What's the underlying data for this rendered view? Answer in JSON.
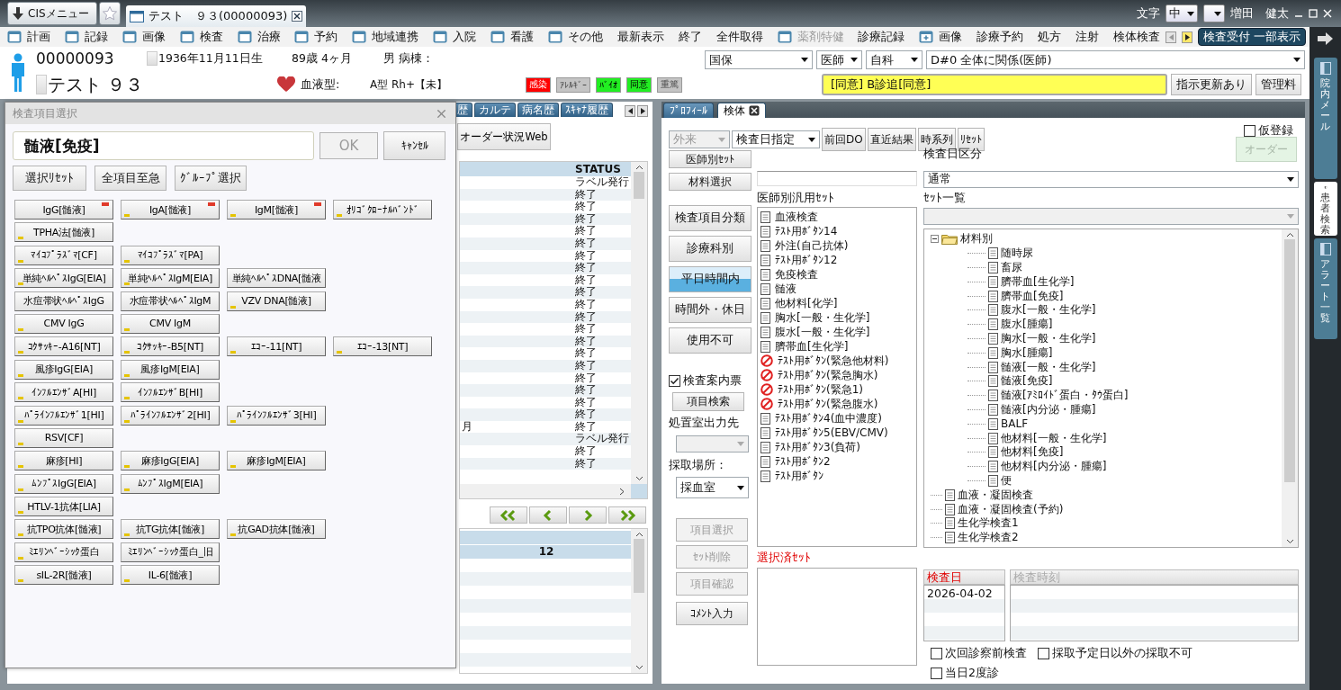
{
  "title_bar": {
    "menu_button": "CISメニュー",
    "tabs": [
      {
        "title": "テスト　９３(00000093)",
        "selected": true
      }
    ],
    "font_label": "文字",
    "font_size": "中",
    "user": "増田　健太"
  },
  "menu_bar": {
    "items": [
      {
        "label": "計画",
        "kind": "window",
        "disabled": false
      },
      {
        "label": "記録",
        "kind": "window",
        "disabled": false
      },
      {
        "label": "画像",
        "kind": "window",
        "disabled": false
      },
      {
        "label": "検査",
        "kind": "window",
        "disabled": false
      },
      {
        "label": "治療",
        "kind": "window",
        "disabled": false
      },
      {
        "label": "予約",
        "kind": "window",
        "disabled": false
      },
      {
        "label": "地域連携",
        "kind": "window",
        "disabled": false
      },
      {
        "label": "入院",
        "kind": "window",
        "disabled": false
      },
      {
        "label": "看護",
        "kind": "window",
        "disabled": false
      },
      {
        "label": "その他",
        "kind": "window",
        "disabled": false
      },
      {
        "label": "最新表示",
        "kind": "text",
        "disabled": false
      },
      {
        "label": "終了",
        "kind": "text",
        "disabled": false
      },
      {
        "label": "全件取得",
        "kind": "text",
        "disabled": false
      },
      {
        "label": "薬剤特健",
        "kind": "window",
        "disabled": true
      },
      {
        "label": "診療記録",
        "kind": "text",
        "disabled": false
      },
      {
        "label": "画像",
        "kind": "plus",
        "disabled": false
      },
      {
        "label": "診療予約",
        "kind": "text",
        "disabled": false
      },
      {
        "label": "処方",
        "kind": "text",
        "disabled": false
      },
      {
        "label": "注射",
        "kind": "text",
        "disabled": false
      },
      {
        "label": "検体検査",
        "kind": "text",
        "disabled": false
      }
    ],
    "action_button": "検査受付 一部表示"
  },
  "patient": {
    "id": "00000093",
    "birth": "1936年11月11日生",
    "age": "89歳 4ヶ月",
    "sex_ward": "男 病棟：",
    "name": "テスト ９３",
    "blood_label": "血液型:",
    "blood_type": "A型 Rh+【未】",
    "flags": [
      {
        "label": "感染",
        "on": true,
        "color": "#ff0000"
      },
      {
        "label": "ｱﾚﾙｷﾞｰ",
        "on": false
      },
      {
        "label": "ﾊﾞｲｵ",
        "on": true,
        "color": "#22ee22"
      },
      {
        "label": "同意",
        "on": true,
        "color": "#22ee22"
      },
      {
        "label": "重篤",
        "on": false
      }
    ],
    "selects": [
      "国保",
      "医師",
      "自科",
      "D#0  全体に関係(医師)"
    ],
    "notice": "[同意] B診追[同意]",
    "buttons": [
      "指示更新あり",
      "管理料"
    ]
  },
  "order_panel": {
    "tabs": [
      {
        "label": "歴",
        "selected": false
      },
      {
        "label": "カルテ",
        "selected": false
      },
      {
        "label": "病名歴",
        "selected": false
      },
      {
        "label": "ｽｷｬﾅ履歴",
        "selected": false
      }
    ],
    "web_button": "オーダー状況Web",
    "status_header": "STATUS",
    "rows": [
      {
        "status": "ラベル発行"
      },
      {
        "status": "終了"
      },
      {
        "status": "終了"
      },
      {
        "status": "終了"
      },
      {
        "status": "終了"
      },
      {
        "status": "終了"
      },
      {
        "status": "終了"
      },
      {
        "status": "終了"
      },
      {
        "status": "終了"
      },
      {
        "status": "終了"
      },
      {
        "status": "終了"
      },
      {
        "status": "終了"
      },
      {
        "status": "終了"
      },
      {
        "status": "終了"
      },
      {
        "status": "終了"
      },
      {
        "status": "終了"
      },
      {
        "status": "終了"
      },
      {
        "status": "終了"
      },
      {
        "status": "終了"
      },
      {
        "status": "終了"
      },
      {
        "column_1": "月",
        "status": "終了"
      },
      {
        "status": "ラベル発行"
      },
      {
        "status": "終了"
      },
      {
        "status": "終了"
      }
    ],
    "lower_row": {
      "value": "12",
      "selected": true
    }
  },
  "dialog": {
    "title": "検査項目選択",
    "selection": "髄液[免疫]",
    "ok": {
      "label": "OK",
      "disabled": true
    },
    "cancel": "ｷｬﾝｾﾙ",
    "actions": [
      "選択ﾘｾｯﾄ",
      "全項目至急",
      "ｸﾞﾙｰﾌﾟ選択"
    ],
    "item_rows": [
      [
        {
          "label": "IgG[髄液]",
          "flagged": true,
          "marked": false
        },
        {
          "label": "IgA[髄液]",
          "flagged": true,
          "marked": true
        },
        {
          "label": "IgM[髄液]",
          "flagged": true,
          "marked": true
        },
        {
          "label": "ｵﾘｺﾞｸﾛｰﾅﾙﾊﾞﾝﾄﾞ",
          "flagged": false,
          "marked": true
        }
      ],
      [
        {
          "label": "TPHA法[髄液]",
          "flagged": false,
          "marked": true
        }
      ],
      [
        {
          "label": "ﾏｲｺﾌﾟﾗｽﾞﾏ[CF]",
          "flagged": false,
          "marked": true
        },
        {
          "label": "ﾏｲｺﾌﾟﾗｽﾞﾏ[PA]",
          "flagged": false,
          "marked": true
        }
      ],
      [
        {
          "label": "単純ﾍﾙﾍﾟｽIgG[EIA]",
          "flagged": false,
          "marked": true
        },
        {
          "label": "単純ﾍﾙﾍﾟｽIgM[EIA]",
          "flagged": false,
          "marked": true
        },
        {
          "label": "単純ﾍﾙﾍﾟｽDNA[髄液",
          "flagged": false,
          "marked": false
        }
      ],
      [
        {
          "label": "水痘帯状ﾍﾙﾍﾟｽIgG",
          "flagged": false,
          "marked": false
        },
        {
          "label": "水痘帯状ﾍﾙﾍﾟｽIgM",
          "flagged": false,
          "marked": false
        },
        {
          "label": "VZV DNA[髄液]",
          "flagged": false,
          "marked": true
        }
      ],
      [
        {
          "label": "CMV IgG",
          "flagged": false,
          "marked": true
        },
        {
          "label": "CMV IgM",
          "flagged": false,
          "marked": true
        }
      ],
      [
        {
          "label": "ｺｸｻｯｷｰ-A16[NT]",
          "flagged": false,
          "marked": true
        },
        {
          "label": "ｺｸｻｯｷｰ-B5[NT]",
          "flagged": false,
          "marked": true
        },
        {
          "label": "ｴｺｰ-11[NT]",
          "flagged": false,
          "marked": true
        },
        {
          "label": "ｴｺｰ-13[NT]",
          "flagged": false,
          "marked": true
        }
      ],
      [
        {
          "label": "風疹IgG[EIA]",
          "flagged": false,
          "marked": true
        },
        {
          "label": "風疹IgM[EIA]",
          "flagged": false,
          "marked": true
        }
      ],
      [
        {
          "label": "ｲﾝﾌﾙｴﾝｻﾞA[HI]",
          "flagged": false,
          "marked": true
        },
        {
          "label": "ｲﾝﾌﾙｴﾝｻﾞB[HI]",
          "flagged": false,
          "marked": true
        }
      ],
      [
        {
          "label": "ﾊﾟﾗｲﾝﾌﾙｴﾝｻﾞ1[HI]",
          "flagged": false,
          "marked": true
        },
        {
          "label": "ﾊﾟﾗｲﾝﾌﾙｴﾝｻﾞ2[HI]",
          "flagged": false,
          "marked": true
        },
        {
          "label": "ﾊﾟﾗｲﾝﾌﾙｴﾝｻﾞ3[HI]",
          "flagged": false,
          "marked": true
        }
      ],
      [
        {
          "label": "RSV[CF]",
          "flagged": false,
          "marked": true
        }
      ],
      [
        {
          "label": "麻疹[HI]",
          "flagged": false,
          "marked": true
        },
        {
          "label": "麻疹IgG[EIA]",
          "flagged": false,
          "marked": true
        },
        {
          "label": "麻疹IgM[EIA]",
          "flagged": false,
          "marked": true
        }
      ],
      [
        {
          "label": "ﾑﾝﾌﾟｽIgG[EIA]",
          "flagged": false,
          "marked": true
        },
        {
          "label": "ﾑﾝﾌﾟｽIgM[EIA]",
          "flagged": false,
          "marked": true
        }
      ],
      [
        {
          "label": "HTLV-1抗体[LIA]",
          "flagged": false,
          "marked": true
        }
      ],
      [
        {
          "label": "抗TPO抗体[髄液]",
          "flagged": false,
          "marked": true
        },
        {
          "label": "抗TG抗体[髄液]",
          "flagged": false,
          "marked": true
        },
        {
          "label": "抗GAD抗体[髄液]",
          "flagged": false,
          "marked": true
        }
      ],
      [
        {
          "label": "ﾐｴﾘﾝﾍﾞｰｼｯｸ蛋白",
          "flagged": false,
          "marked": true
        },
        {
          "label": "ﾐｴﾘﾝﾍﾞｰｼｯｸ蛋白_旧",
          "flagged": false,
          "marked": false
        }
      ],
      [
        {
          "label": "sIL-2R[髄液]",
          "flagged": false,
          "marked": true
        },
        {
          "label": "IL-6[髄液]",
          "flagged": false,
          "marked": true
        }
      ]
    ]
  },
  "right_panel": {
    "tabs": [
      {
        "label": "ﾌﾟﾛﾌｨｰﾙ",
        "selected": false,
        "closable": false
      },
      {
        "label": "検体",
        "selected": true,
        "closable": true
      }
    ],
    "visit_select": {
      "value": "外来",
      "disabled": true
    },
    "date_mode_select": {
      "value": "検査日指定",
      "disabled": false
    },
    "toolbar_buttons": [
      "前回DO",
      "直近結果",
      "時系列",
      "ﾘｾｯﾄ"
    ],
    "provisional": {
      "label": "仮登録",
      "checked": false
    },
    "order_button": {
      "label": "オーダー",
      "disabled": true
    },
    "side_buttons": [
      "医師別ｾｯﾄ",
      "材料選択"
    ],
    "category_buttons": [
      {
        "label": "検査項目分類",
        "selected": false
      },
      {
        "label": "診療科別",
        "selected": false
      },
      {
        "label": "平日時間内",
        "selected": true
      },
      {
        "label": "時間外・休日",
        "selected": false
      },
      {
        "label": "使用不可",
        "selected": false
      }
    ],
    "guide_check": {
      "label": "検査案内票",
      "checked": true
    },
    "item_search": "項目検索",
    "output_label": "処置室出力先",
    "output_select": {
      "disabled": true
    },
    "place_label": "採取場所：",
    "place_select": "採血室",
    "action_buttons": [
      {
        "label": "項目選択",
        "disabled": true
      },
      {
        "label": "ｾｯﾄ削除",
        "disabled": true
      },
      {
        "label": "項目確認",
        "disabled": true
      },
      {
        "label": "ｺﾒﾝﾄ入力",
        "disabled": false
      }
    ],
    "doctor_sets": {
      "label": "医師別汎用ｾｯﾄ",
      "items": [
        {
          "label": "血液検査",
          "kind": "document"
        },
        {
          "label": "ﾃｽﾄ用ﾎﾞﾀﾝ14",
          "kind": "document"
        },
        {
          "label": "外注(自己抗体)",
          "kind": "document"
        },
        {
          "label": "ﾃｽﾄ用ﾎﾞﾀﾝ12",
          "kind": "document"
        },
        {
          "label": "免疫検査",
          "kind": "document"
        },
        {
          "label": "髄液",
          "kind": "document"
        },
        {
          "label": "他材料[化学]",
          "kind": "document"
        },
        {
          "label": "胸水[一般・生化学]",
          "kind": "document"
        },
        {
          "label": "腹水[一般・生化学]",
          "kind": "document"
        },
        {
          "label": "臍帯血[生化学]",
          "kind": "document"
        },
        {
          "label": "ﾃｽﾄ用ﾎﾞﾀﾝ(緊急他材料)",
          "kind": "blocked"
        },
        {
          "label": "ﾃｽﾄ用ﾎﾞﾀﾝ(緊急胸水)",
          "kind": "blocked"
        },
        {
          "label": "ﾃｽﾄ用ﾎﾞﾀﾝ(緊急1)",
          "kind": "blocked"
        },
        {
          "label": "ﾃｽﾄ用ﾎﾞﾀﾝ(緊急腹水)",
          "kind": "blocked"
        },
        {
          "label": "ﾃｽﾄ用ﾎﾞﾀﾝ4(血中濃度)",
          "kind": "document"
        },
        {
          "label": "ﾃｽﾄ用ﾎﾞﾀﾝ5(EBV/CMV)",
          "kind": "document"
        },
        {
          "label": "ﾃｽﾄ用ﾎﾞﾀﾝ3(負荷)",
          "kind": "document"
        },
        {
          "label": "ﾃｽﾄ用ﾎﾞﾀﾝ2",
          "kind": "document"
        },
        {
          "label": "ﾃｽﾄ用ﾎﾞﾀﾝ",
          "kind": "document"
        }
      ]
    },
    "selected_sets_label": "選択済ｾｯﾄ",
    "date_category": {
      "label": "検査日区分",
      "value": "通常"
    },
    "set_list_label": "ｾｯﾄ一覧",
    "tree": [
      {
        "label": "材料別",
        "expanded": true,
        "children": [
          {
            "label": "随時尿"
          },
          {
            "label": "畜尿"
          },
          {
            "label": "臍帯血[生化学]"
          },
          {
            "label": "臍帯血[免疫]"
          },
          {
            "label": "腹水[一般・生化学]"
          },
          {
            "label": "腹水[腫瘍]"
          },
          {
            "label": "胸水[一般・生化学]"
          },
          {
            "label": "胸水[腫瘍]"
          },
          {
            "label": "髄液[一般・生化学]"
          },
          {
            "label": "髄液[免疫]"
          },
          {
            "label": "髄液[ｱﾐﾛｲﾄﾞ蛋白・ﾀｳ蛋白]"
          },
          {
            "label": "髄液[内分泌・腫瘍]"
          },
          {
            "label": "BALF"
          },
          {
            "label": "他材料[一般・生化学]"
          },
          {
            "label": "他材料[免疫]"
          },
          {
            "label": "他材料[内分泌・腫瘍]"
          },
          {
            "label": "便"
          }
        ]
      },
      {
        "label": "血液・凝固検査"
      },
      {
        "label": "血液・凝固検査(予約)"
      },
      {
        "label": "生化学検査1"
      },
      {
        "label": "生化学検査2"
      }
    ],
    "exam_date": {
      "label": "検査日",
      "values": [
        "2026-04-02"
      ]
    },
    "exam_time_label": "検査時刻",
    "options": [
      {
        "label": "次回診察前検査",
        "checked": false
      },
      {
        "label": "採取予定日以外の採取不可",
        "checked": false
      },
      {
        "label": "当日2度診",
        "checked": false
      }
    ]
  },
  "side_tabs": [
    {
      "label": "院内メール",
      "selected": false
    },
    {
      "label": "患者検索",
      "selected": true
    },
    {
      "label": "アラート一覧",
      "selected": false
    }
  ]
}
